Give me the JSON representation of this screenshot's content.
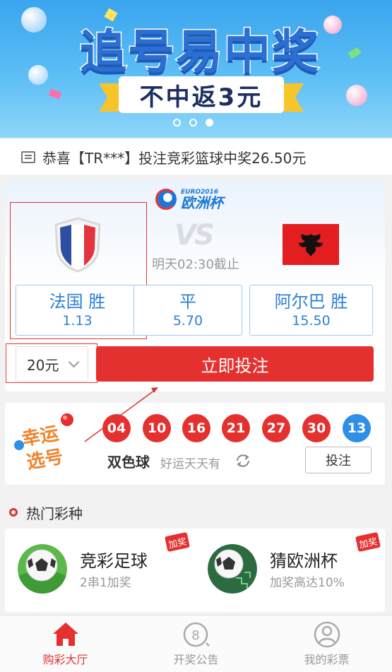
{
  "banner": {
    "title": "追号易中奖",
    "subtitle": "不中返3元",
    "dots": 3,
    "active_dot": 2
  },
  "notice": {
    "text": "恭喜【TR***】投注竞彩篮球中奖26.50元"
  },
  "match": {
    "league_year": "EURO2016",
    "league_name": "欧洲杯",
    "vs": "VS",
    "deadline": "明天02:30截止",
    "odds": [
      {
        "label": "法国 胜",
        "value": "1.13"
      },
      {
        "label": "平",
        "value": "5.70"
      },
      {
        "label": "阿尔巴 胜",
        "value": "15.50"
      }
    ],
    "amount": "20元",
    "bet_button": "立即投注"
  },
  "lotto": {
    "logo_text": "幸运选号",
    "red_balls": [
      "04",
      "10",
      "16",
      "21",
      "27",
      "30"
    ],
    "blue_ball": "13",
    "name": "双色球",
    "slogan": "好运天天有",
    "bet_button": "投注"
  },
  "hot": {
    "title": "热门彩种",
    "games": [
      {
        "name": "竞彩足球",
        "desc": "2串1加奖",
        "tag": "加奖"
      },
      {
        "name": "猜欧洲杯",
        "desc": "加奖高达10%",
        "tag": "加奖"
      }
    ]
  },
  "tabs": [
    {
      "label": "购彩大厅",
      "icon": "home-icon",
      "active": true
    },
    {
      "label": "开奖公告",
      "icon": "lottery-ball-icon",
      "active": false
    },
    {
      "label": "我的彩票",
      "icon": "user-icon",
      "active": false
    }
  ],
  "colors": {
    "accent_red": "#e4302f",
    "accent_blue": "#2c7fd6"
  }
}
